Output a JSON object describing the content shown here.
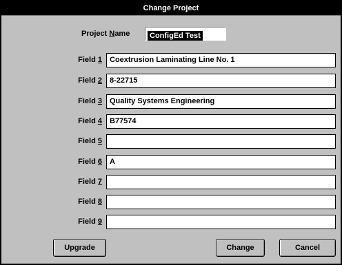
{
  "dialog": {
    "title": "Change Project"
  },
  "project_name": {
    "label_prefix": "Project ",
    "label_mnemonic": "N",
    "label_suffix": "ame",
    "value": "ConfigEd Test"
  },
  "fields": [
    {
      "label_prefix": "Field ",
      "mnemonic": "1",
      "value": "Coextrusion Laminating Line No. 1"
    },
    {
      "label_prefix": "Field ",
      "mnemonic": "2",
      "value": "8-22715"
    },
    {
      "label_prefix": "Field ",
      "mnemonic": "3",
      "value": "Quality Systems Engineering"
    },
    {
      "label_prefix": "Field ",
      "mnemonic": "4",
      "value": "B77574"
    },
    {
      "label_prefix": "Field ",
      "mnemonic": "5",
      "value": ""
    },
    {
      "label_prefix": "Field ",
      "mnemonic": "6",
      "value": "A"
    },
    {
      "label_prefix": "Field ",
      "mnemonic": "7",
      "value": ""
    },
    {
      "label_prefix": "Field ",
      "mnemonic": "8",
      "value": ""
    },
    {
      "label_prefix": "Field ",
      "mnemonic": "9",
      "value": ""
    }
  ],
  "buttons": {
    "upgrade": "Upgrade",
    "change": "Change",
    "cancel": "Cancel"
  }
}
